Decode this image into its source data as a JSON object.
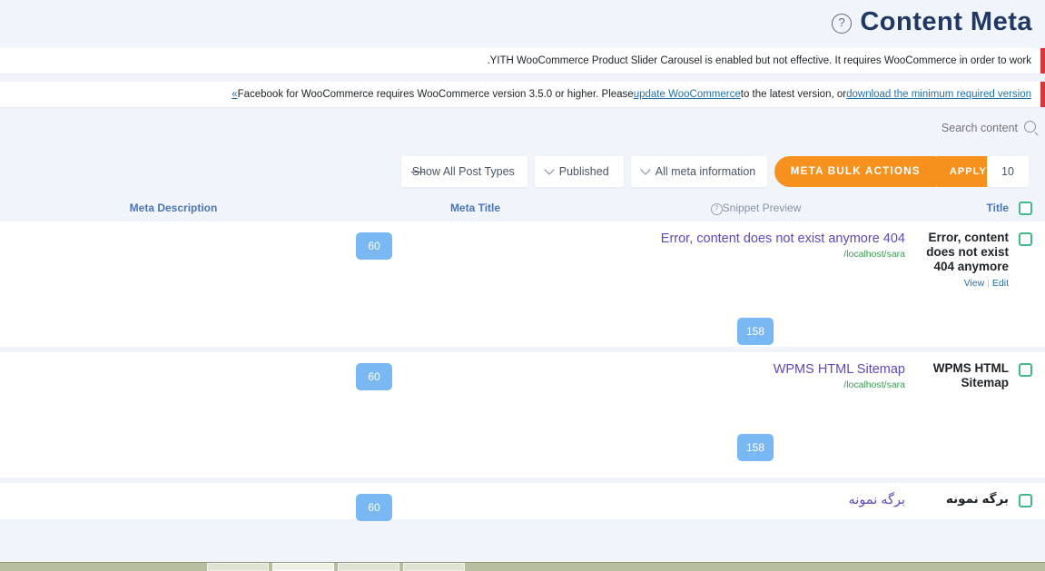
{
  "header": {
    "title": "Content Meta",
    "help_icon": "question-circle-icon"
  },
  "notices": [
    {
      "text": ".YITH WooCommerce Product Slider Carousel is enabled but not effective. It requires WooCommerce in order to work",
      "accent_color": "#d63638"
    },
    {
      "dismiss": "«",
      "prefix": "Facebook for WooCommerce requires WooCommerce version 3.5.0 or higher. Please ",
      "link1": "update WooCommerce",
      "middle": " to the latest version, or ",
      "link2": "download the minimum required version",
      "accent_color": "#d63638"
    }
  ],
  "search": {
    "placeholder": "Search content",
    "value": "",
    "icon": "magnifier-icon"
  },
  "toolbar": {
    "count_value": "10",
    "apply_label": "APPLY",
    "bulk_label": "META BULK ACTIONS",
    "meta_filter": "All meta information",
    "status_filter": "Published",
    "post_type_filter": "Show All Post Types",
    "accent_color": "#f7911e"
  },
  "table": {
    "headers": {
      "meta_description": "Meta Description",
      "meta_title": "Meta Title",
      "snippet_preview": "Snippet Preview",
      "title": "Title"
    },
    "checkbox_color": "#43b88a",
    "badge_color": "#79b8f3",
    "rows": [
      {
        "title": "Error, content does not exist 404 anymore",
        "view_label": "View",
        "sep": "|",
        "edit_label": "Edit",
        "snippet_title": "Error, content does not exist anymore 404",
        "snippet_url": "/localhost/sara",
        "meta_title_badge": "60",
        "meta_desc_badge": "158",
        "rtl": false
      },
      {
        "title": "WPMS HTML Sitemap",
        "view_label": "",
        "sep": "",
        "edit_label": "",
        "snippet_title": "WPMS HTML Sitemap",
        "snippet_url": "/localhost/sara",
        "meta_title_badge": "60",
        "meta_desc_badge": "158",
        "rtl": false
      },
      {
        "title": "برگه نمونه",
        "view_label": "",
        "sep": "",
        "edit_label": "",
        "snippet_title": "برگه نمونه",
        "snippet_url": "",
        "meta_title_badge": "60",
        "meta_desc_badge": "",
        "rtl": true
      }
    ]
  },
  "taskbar": {
    "buttons": [
      "",
      "",
      "",
      ""
    ]
  }
}
